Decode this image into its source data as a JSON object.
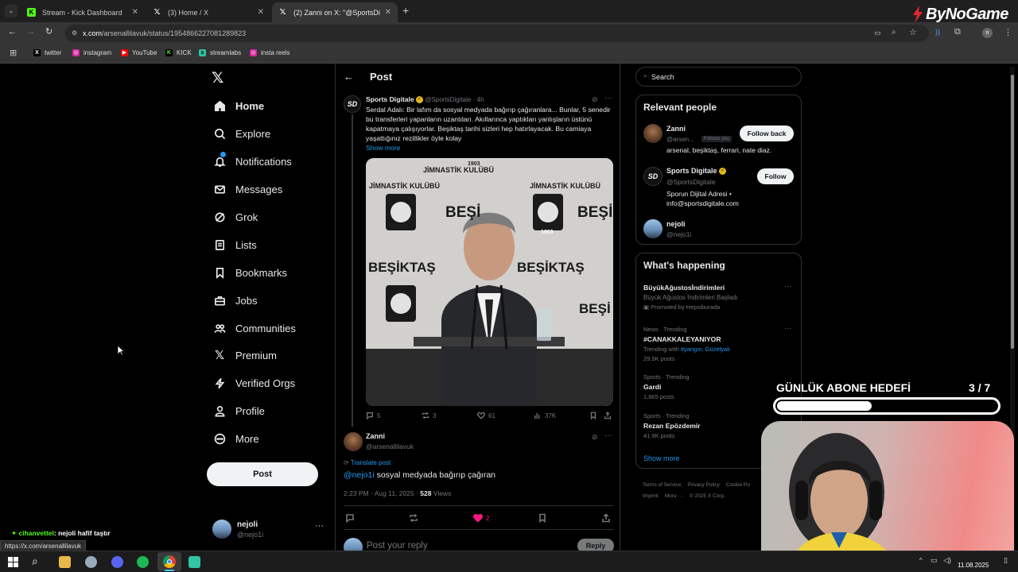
{
  "browser": {
    "tabs": [
      {
        "title": "Stream - Kick Dashboard",
        "active": false,
        "favicon": "kick-logo"
      },
      {
        "title": "(3) Home / X",
        "active": false,
        "favicon": "x-logo"
      },
      {
        "title": "(2) Zanni on X: \"@SportsDigitale",
        "active": true,
        "favicon": "x-logo"
      }
    ],
    "url_domain": "x.com",
    "url_path": "/arsenallilavuk/status/1954866227081289823",
    "bookmarks": [
      "twitter",
      "instagram",
      "YouTube",
      "KICK",
      "streamlabs",
      "insta reels"
    ],
    "status_url": "https://x.com/arsenallilavuk"
  },
  "watermark": "ByNoGame",
  "nav": {
    "items": [
      "Home",
      "Explore",
      "Notifications",
      "Messages",
      "Grok",
      "Lists",
      "Bookmarks",
      "Jobs",
      "Communities",
      "Premium",
      "Verified Orgs",
      "Profile",
      "More"
    ],
    "post_label": "Post",
    "account": {
      "name": "nejoli",
      "handle": "@nejo1i"
    }
  },
  "post_header": "Post",
  "original_tweet": {
    "author": "Sports Digitale",
    "handle": "@SportsDigitale",
    "time": "· 4h",
    "avatar_text": "SD",
    "text": "Serdal Adalı: Bir lafım da sosyal medyada bağırıp çağıranlara... Bunlar, 5 senedir bu transferleri yapanların uzantıları. Akıllarınca yaptıkları yanlışların üstünü kapatmaya çalışıyorlar. Beşiktaş tarihi sizleri hep hatırlayacak. Bu camiaya yaşattığınız rezillikler öyle kolay",
    "show_more": "Show more",
    "image_texts": {
      "club": "JİMNASTİK KULÜBÜ",
      "name": "BEŞİKTAŞ",
      "short": "BEŞİ",
      "year": "1903"
    },
    "replies": "5",
    "reposts": "3",
    "likes": "61",
    "views": "37K"
  },
  "reply_tweet": {
    "author": "Zanni",
    "handle": "@arsenallilavuk",
    "translate": "Translate post",
    "mention": "@nejo1i",
    "text": " sosyal medyada bağırıp çağıran",
    "timestamp": "2:23 PM · Aug 11, 2025 · ",
    "views_count": "528",
    "views_label": " Views",
    "likes": "2"
  },
  "reply_box": {
    "placeholder": "Post your reply",
    "button": "Reply"
  },
  "search": {
    "placeholder": "Search"
  },
  "relevant_people": {
    "title": "Relevant people",
    "people": [
      {
        "name": "Zanni",
        "handle": "@arsen...",
        "badge": "Follows you",
        "bio": "arsenal, beşiktaş, ferrari, nate diaz.",
        "button": "Follow back"
      },
      {
        "name": "Sports Digitale",
        "handle": "@SportsDigitale",
        "bio": "Sporun Dijital Adresi • info@sportsdigitale.com",
        "button": "Follow"
      },
      {
        "name": "nejoli",
        "handle": "@nejo1i"
      }
    ]
  },
  "whats_happening": {
    "title": "What's happening",
    "trends": [
      {
        "meta": "",
        "title": "BüyükAğustosİndirimleri",
        "sub": "Büyük Ağustos İndirimleri Başladı",
        "extra": "Promoted by Hepsiburada"
      },
      {
        "meta": "News · Trending",
        "title": "#CANAKKALEYANIYOR",
        "sub_prefix": "Trending with ",
        "sub_links": "#yangın, Güzelyalı",
        "count": "29.5K posts"
      },
      {
        "meta": "Sports · Trending",
        "title": "Gardi",
        "count": "1,865 posts"
      },
      {
        "meta": "Sports · Trending",
        "title": "Rezan Epözdemir",
        "count": "41.9K posts"
      }
    ],
    "show_more": "Show more"
  },
  "footer_links": [
    "Terms of Service",
    "Privacy Policy",
    "Cookie Po",
    "Imprint",
    "More ···",
    "© 2025 X Corp."
  ],
  "stream_goal": {
    "label": "GÜNLÜK ABONE HEDEFİ",
    "current": "3",
    "separator": "/",
    "target": "7",
    "progress": 0.43
  },
  "chat_message": {
    "user": "cihanvettel",
    "text": ": nejoli hafif taştır"
  },
  "taskbar": {
    "date": "11.08.2025"
  },
  "colors": {
    "accent": "#1d9bf0",
    "like": "#f91880",
    "bg": "#000000",
    "border": "#2f3336",
    "muted": "#71767b"
  }
}
